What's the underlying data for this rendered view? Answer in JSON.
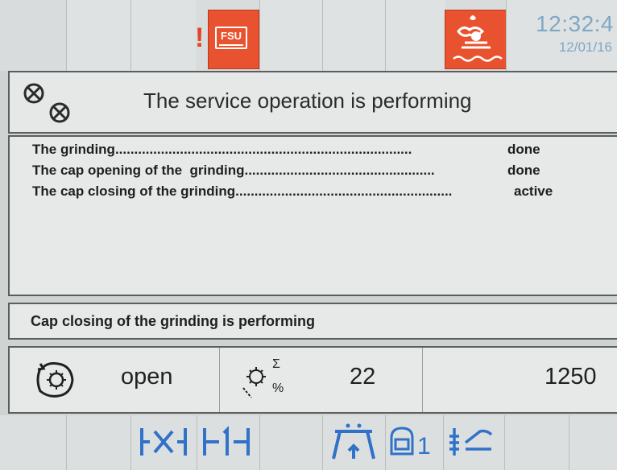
{
  "header": {
    "clock_time": "12:32:4",
    "clock_date": "12/01/16",
    "warning_mark": "!",
    "fsu_label": "FSU",
    "icons": [
      "warning-icon",
      "fsu-icon",
      "grinding-water-icon"
    ],
    "colors": {
      "alarm_tile": "#e9522e",
      "clock": "#7fa7c6"
    }
  },
  "title": {
    "text": "The service operation is performing",
    "icon": "gears-icon"
  },
  "log": {
    "rows": [
      {
        "label": "The grinding",
        "dots": "..............................................................................",
        "status": "done"
      },
      {
        "label": "The cap opening of the  grinding",
        "dots": "..................................................",
        "status": "done"
      },
      {
        "label": "The cap closing of the grinding",
        "dots": ".........................................................",
        "status": "active"
      }
    ]
  },
  "status_message": "Cap closing of the grinding is performing",
  "info": {
    "cap_state": "open",
    "cap_icon": "cap-dial-icon",
    "counter_icon": "grind-counter-icon",
    "counter_sigma": "Σ",
    "counter_percent": "%",
    "counter_value": "22",
    "total_value": "1250"
  },
  "toolbar": {
    "buttons": [
      {
        "icon": "width-adjust-icon",
        "text": "|X|"
      },
      {
        "icon": "width-fixed-icon",
        "text": "|↕|"
      },
      {
        "icon": "lift-icon",
        "text": "⩚"
      },
      {
        "icon": "memory-1-icon",
        "text": "1"
      },
      {
        "icon": "level-icon",
        "text": "≡"
      }
    ],
    "color": "#2f72c8"
  }
}
